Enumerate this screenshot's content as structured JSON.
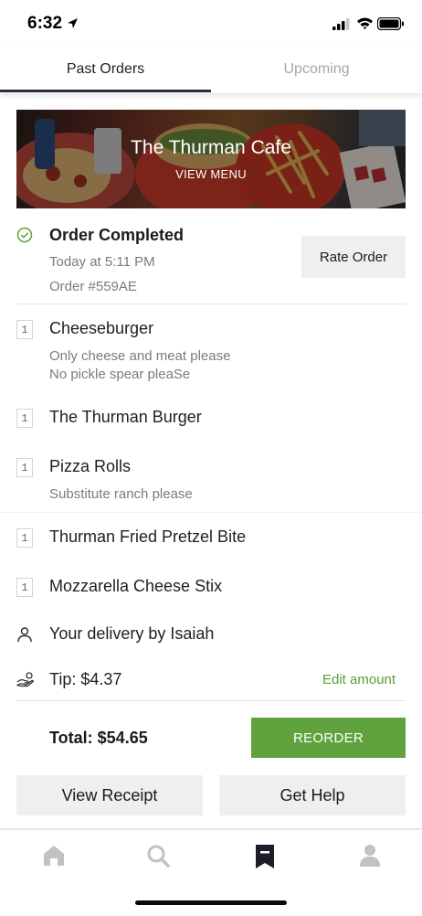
{
  "status_bar": {
    "time": "6:32"
  },
  "tabs": [
    {
      "label": "Past Orders",
      "active": true
    },
    {
      "label": "Upcoming",
      "active": false
    }
  ],
  "restaurant": {
    "name": "The Thurman Cafe",
    "view_menu": "VIEW MENU"
  },
  "order": {
    "status": "Order Completed",
    "time": "Today at 5:11 PM",
    "number": "Order #559AE",
    "rate_label": "Rate Order"
  },
  "items": [
    {
      "qty": "1",
      "name": "Cheeseburger",
      "notes": [
        "Only  cheese and meat please",
        "No pickle spear pleaSe"
      ]
    },
    {
      "qty": "1",
      "name": "The Thurman Burger",
      "notes": []
    },
    {
      "qty": "1",
      "name": "Pizza Rolls",
      "notes": [
        "Substitute ranch please"
      ]
    },
    {
      "qty": "1",
      "name": "Thurman Fried Pretzel Bite",
      "notes": []
    },
    {
      "qty": "1",
      "name": "Mozzarella Cheese Stix",
      "notes": []
    }
  ],
  "delivery": {
    "text": "Your delivery by Isaiah"
  },
  "tip": {
    "text": "Tip: $4.37",
    "edit_label": "Edit amount"
  },
  "total": {
    "text": "Total: $54.65",
    "reorder_label": "REORDER"
  },
  "actions": {
    "receipt_label": "View Receipt",
    "help_label": "Get Help"
  },
  "bottom_nav": [
    "home-icon",
    "search-icon",
    "orders-icon",
    "account-icon"
  ],
  "colors": {
    "accent_green": "#5fa23e",
    "tab_underline": "#2b2a3a",
    "muted_text": "#7b7b7b"
  }
}
